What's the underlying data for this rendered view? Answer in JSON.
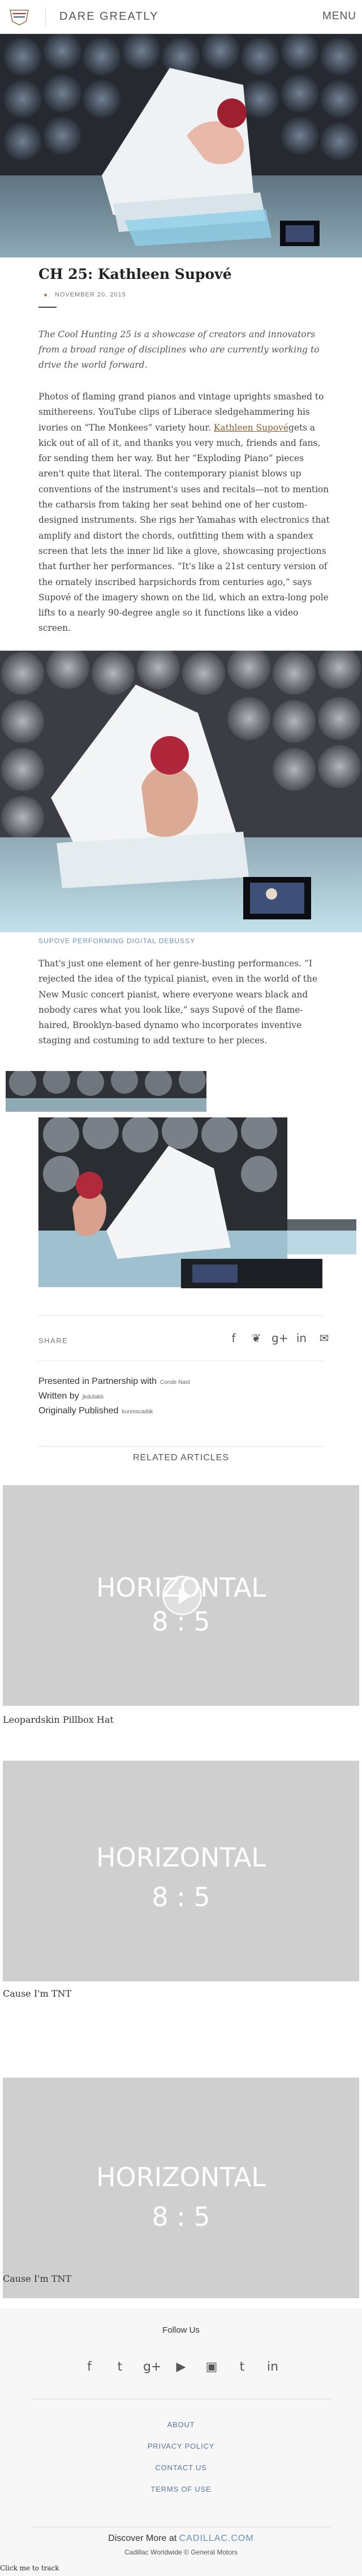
{
  "header": {
    "logo_text": "Cadillac",
    "site_title": "DARE GREATLY",
    "menu_label": "MENU"
  },
  "article": {
    "title": "CH 25: Kathleen Supové",
    "date": "NOVEMBER 20, 2015",
    "intro": "The Cool Hunting 25 is a showcase of creators and innovators from a broad range of disciplines who are currently working to drive the world forward.",
    "p1_a": "Photos of flaming grand pianos and vintage uprights smashed to smithereens. YouTube clips of Liberace sledgehammering his ivories on “The Monkees” variety hour. ",
    "p1_link": "Kathleen Supové",
    "p1_b": "gets a kick out of all of it, and thanks you very much, friends and fans, for sending them her way. But her “Exploding Piano” pieces aren't quite that literal. The contemporary pianist blows up conventions of the instrument's uses and recitals—not to mention the catharsis from taking her seat behind one of her custom-designed instruments. She rigs her Yamahas with electronics that amplify and distort the chords, outfitting them with a spandex screen that lets the inner lid like a glove, showcasing projections that further her performances. “It's like a 21st century version of the ornately inscribed harpsichords from centuries ago,” says Supové of the imagery shown on the lid, which an extra-long pole lifts to a nearly 90-degree angle so it functions like a video screen.",
    "caption": "SUPOVE PERFORMING DIGITAL DEBUSSY",
    "p2": "That's just one element of her genre-busting performances. “I rejected the idea of the typical pianist, even in the world of the New Music concert pianist, where everyone wears black and nobody cares what you look like,” says Supové of the flame-haired, Brooklyn-based dynamo who incorporates inventive staging and costuming to add texture to her pieces."
  },
  "share": {
    "label": "SHARE",
    "icons": [
      "facebook-icon",
      "twitter-icon",
      "google-plus-icon",
      "linkedin-icon",
      "email-icon"
    ],
    "glyphs": [
      "f",
      "❦",
      "g+",
      "in",
      "✉"
    ]
  },
  "credits": {
    "partnership_label": "Presented in Partnership with",
    "partnership_value": "Conde Nast",
    "written_label": "Written by",
    "written_value": "jkdufakb",
    "published_label": "Originally Published",
    "published_value": "kunmscadiik"
  },
  "related": {
    "title": "RELATED ARTICLES",
    "placeholder_line1": "HORIZONTAL",
    "placeholder_line2": "8 : 5",
    "items": [
      {
        "label": "Leopardskin Pillbox Hat"
      },
      {
        "label": "Cause I'm TNT"
      },
      {
        "label": "Cause I'm TNT"
      }
    ]
  },
  "footer": {
    "follow_us": "Follow Us",
    "social": [
      "facebook-icon",
      "twitter-icon",
      "google-plus-icon",
      "youtube-icon",
      "instagram-icon",
      "tumblr-icon",
      "linkedin-icon"
    ],
    "social_glyphs": [
      "f",
      "t",
      "g+",
      "▶",
      "▣",
      "t",
      "in"
    ],
    "links": [
      "ABOUT",
      "PRIVACY POLICY",
      "CONTACT US",
      "TERMS OF USE"
    ],
    "discover_prefix": "Discover More at ",
    "discover_link": "CADILLAC.COM",
    "gm_line": "Cadillac Worldwide © General Motors"
  },
  "click_track": "Click me to track",
  "colors": {
    "accent_link": "#8a5a2b",
    "caption_blue": "#6a8fb8",
    "placeholder_gray": "#cfcfcf"
  }
}
